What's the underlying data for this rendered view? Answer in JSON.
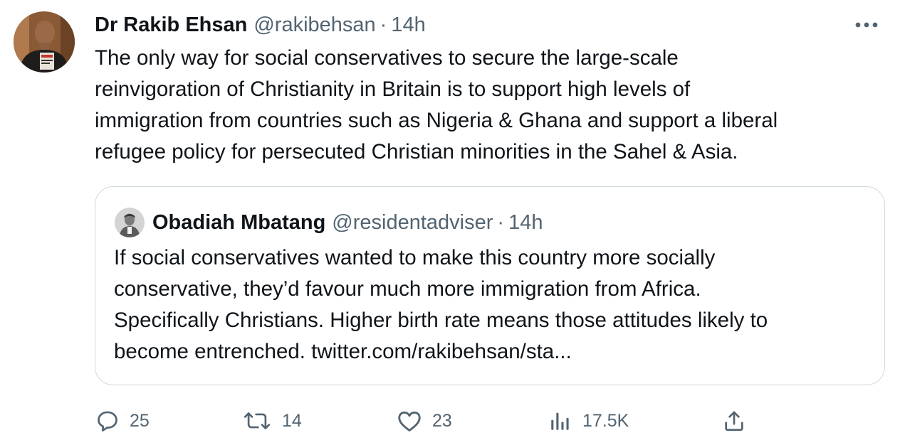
{
  "tweet": {
    "author": {
      "display_name": "Dr Rakib Ehsan",
      "handle": "@rakibehsan",
      "time": "14h"
    },
    "separator": "·",
    "text_lines": [
      "The only way for social conservatives to secure the large-scale",
      "reinvigoration of Christianity in Britain is to support high levels of",
      "immigration from countries such as Nigeria & Ghana and support a liberal",
      "refugee policy for persecuted Christian minorities in the Sahel & Asia."
    ]
  },
  "quote": {
    "author": {
      "display_name": "Obadiah Mbatang",
      "handle": "@residentadviser",
      "time": "14h"
    },
    "separator": "·",
    "text_lines": [
      "If social conservatives wanted to make this country more socially",
      "conservative, they’d favour much more immigration from Africa.",
      "Specifically Christians. Higher birth rate means those attitudes likely to",
      "become entrenched. twitter.com/rakibehsan/sta..."
    ]
  },
  "actions": {
    "replies": "25",
    "retweets": "14",
    "likes": "23",
    "views": "17.5K"
  },
  "icons": {
    "more": "more-horizontal-icon",
    "reply": "reply-icon",
    "retweet": "retweet-icon",
    "like": "heart-icon",
    "views": "analytics-icon",
    "share": "share-icon"
  },
  "colors": {
    "text": "#0f1419",
    "secondary": "#536471",
    "border": "#cfd9de"
  }
}
